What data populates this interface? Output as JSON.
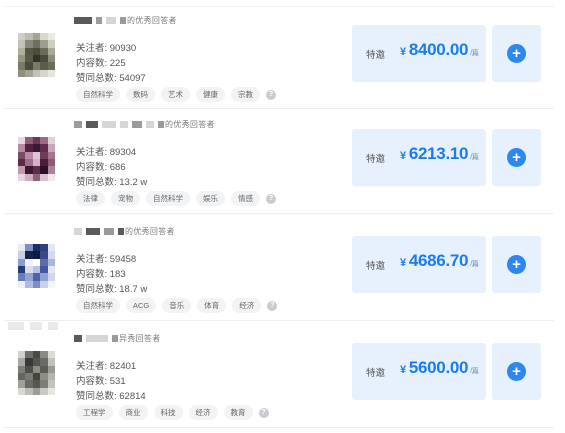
{
  "cards": [
    {
      "title_suffix": "的优秀回答者",
      "followers": "关注者: 90930",
      "contents": "内容数: 225",
      "likes": "赞同总数: 54097",
      "tags": [
        "自然科学",
        "数码",
        "艺术",
        "健康",
        "宗教"
      ],
      "invite_label": "特邀",
      "currency": "¥",
      "price": "8400.00",
      "price_unit": "/篇",
      "avatar_colors": [
        "#cfcfc4",
        "#bdbdb0",
        "#a5a597",
        "#d8d8cc",
        "#e9e9e0",
        "#c4c4b6",
        "#8a8a7c",
        "#6f6f60",
        "#9d9d8e",
        "#cfcfc0",
        "#b0b0a0",
        "#575744",
        "#4d4d3b",
        "#6b6b58",
        "#a8a898",
        "#96967f",
        "#5a5a47",
        "#33332a",
        "#4a4a3a",
        "#8c8c78",
        "#7a7a66",
        "#4c4c3d",
        "#7b7b68",
        "#5d5d4c",
        "#6d6d5a",
        "#8f8f7d",
        "#a3a394",
        "#c2c2b5",
        "#d6d6ca",
        "#e6e6dd"
      ]
    },
    {
      "title_suffix": "的优秀回答者",
      "followers": "关注者: 89304",
      "contents": "内容数: 686",
      "likes": "赞同总数: 13.2 w",
      "tags": [
        "法律",
        "宠物",
        "自然科学",
        "娱乐",
        "情感"
      ],
      "invite_label": "特邀",
      "currency": "¥",
      "price": "6213.10",
      "price_unit": "/篇",
      "avatar_colors": [
        "#e8d7e0",
        "#8f5f78",
        "#6b3a57",
        "#9d6a86",
        "#e3d0db",
        "#b58aa2",
        "#4e2240",
        "#3a1a33",
        "#5e2e4d",
        "#c9a6b9",
        "#7a4a66",
        "#b88aa3",
        "#e0c4d2",
        "#6e3d5a",
        "#a37590",
        "#5a2a48",
        "#9e6f88",
        "#d6b3c4",
        "#4a1d3b",
        "#8c5a76",
        "#c29ab0",
        "#3d1632",
        "#5e2d4b",
        "#2e1026",
        "#a8839a",
        "#e6d5de",
        "#cdb0c0",
        "#8a6379",
        "#d9c2cf",
        "#f0e6eb"
      ]
    },
    {
      "title_suffix": "的优秀回答者",
      "followers": "关注者: 59458",
      "contents": "内容数: 183",
      "likes": "赞同总数: 18.7 w",
      "tags": [
        "自然科学",
        "ACG",
        "音乐",
        "体育",
        "经济"
      ],
      "invite_label": "特邀",
      "currency": "¥",
      "price": "4686.70",
      "price_unit": "/篇",
      "avatar_colors": [
        "#e8ecf5",
        "#7c8fc2",
        "#1d2b63",
        "#2f3f7a",
        "#e1e6f2",
        "#c6cfe6",
        "#14224f",
        "#0f1a40",
        "#3a4a86",
        "#d4dbee",
        "#8a9bd0",
        "#f0f2f8",
        "#ffffff",
        "#5b6daa",
        "#aab7df",
        "#2a3978",
        "#d9deef",
        "#b7c2e3",
        "#4556a0",
        "#e4e8f4",
        "#6b7cba",
        "#93a3d6",
        "#5063a8",
        "#8fa0d4",
        "#cfd6ec",
        "#eef0f8",
        "#b0bce2",
        "#7d8ec6",
        "#c9d1ea",
        "#f3f5fa"
      ]
    },
    {
      "title_suffix": "异秀回答者",
      "followers": "关注者: 82401",
      "contents": "内容数: 531",
      "likes": "赞同总数: 62814",
      "tags": [
        "工程学",
        "商业",
        "科技",
        "经济",
        "教育"
      ],
      "invite_label": "特邀",
      "currency": "¥",
      "price": "5600.00",
      "price_unit": "/篇",
      "avatar_colors": [
        "#d0d0cc",
        "#6f6f6a",
        "#4a4a45",
        "#8a8a84",
        "#dcdcd7",
        "#aaaaa4",
        "#3a3a35",
        "#55554f",
        "#6a6a64",
        "#c2c2bc",
        "#7e7e78",
        "#4f4f49",
        "#8d8d86",
        "#5c5c56",
        "#9a9a94",
        "#66665f",
        "#7a7a73",
        "#45453f",
        "#8f8f88",
        "#b4b4ae",
        "#a0a09a",
        "#6b6b65",
        "#57574f",
        "#7d7d76",
        "#c4c4be",
        "#d8d8d3",
        "#bdbdb7",
        "#9d9d97",
        "#cacac4",
        "#e6e6e2"
      ]
    }
  ]
}
